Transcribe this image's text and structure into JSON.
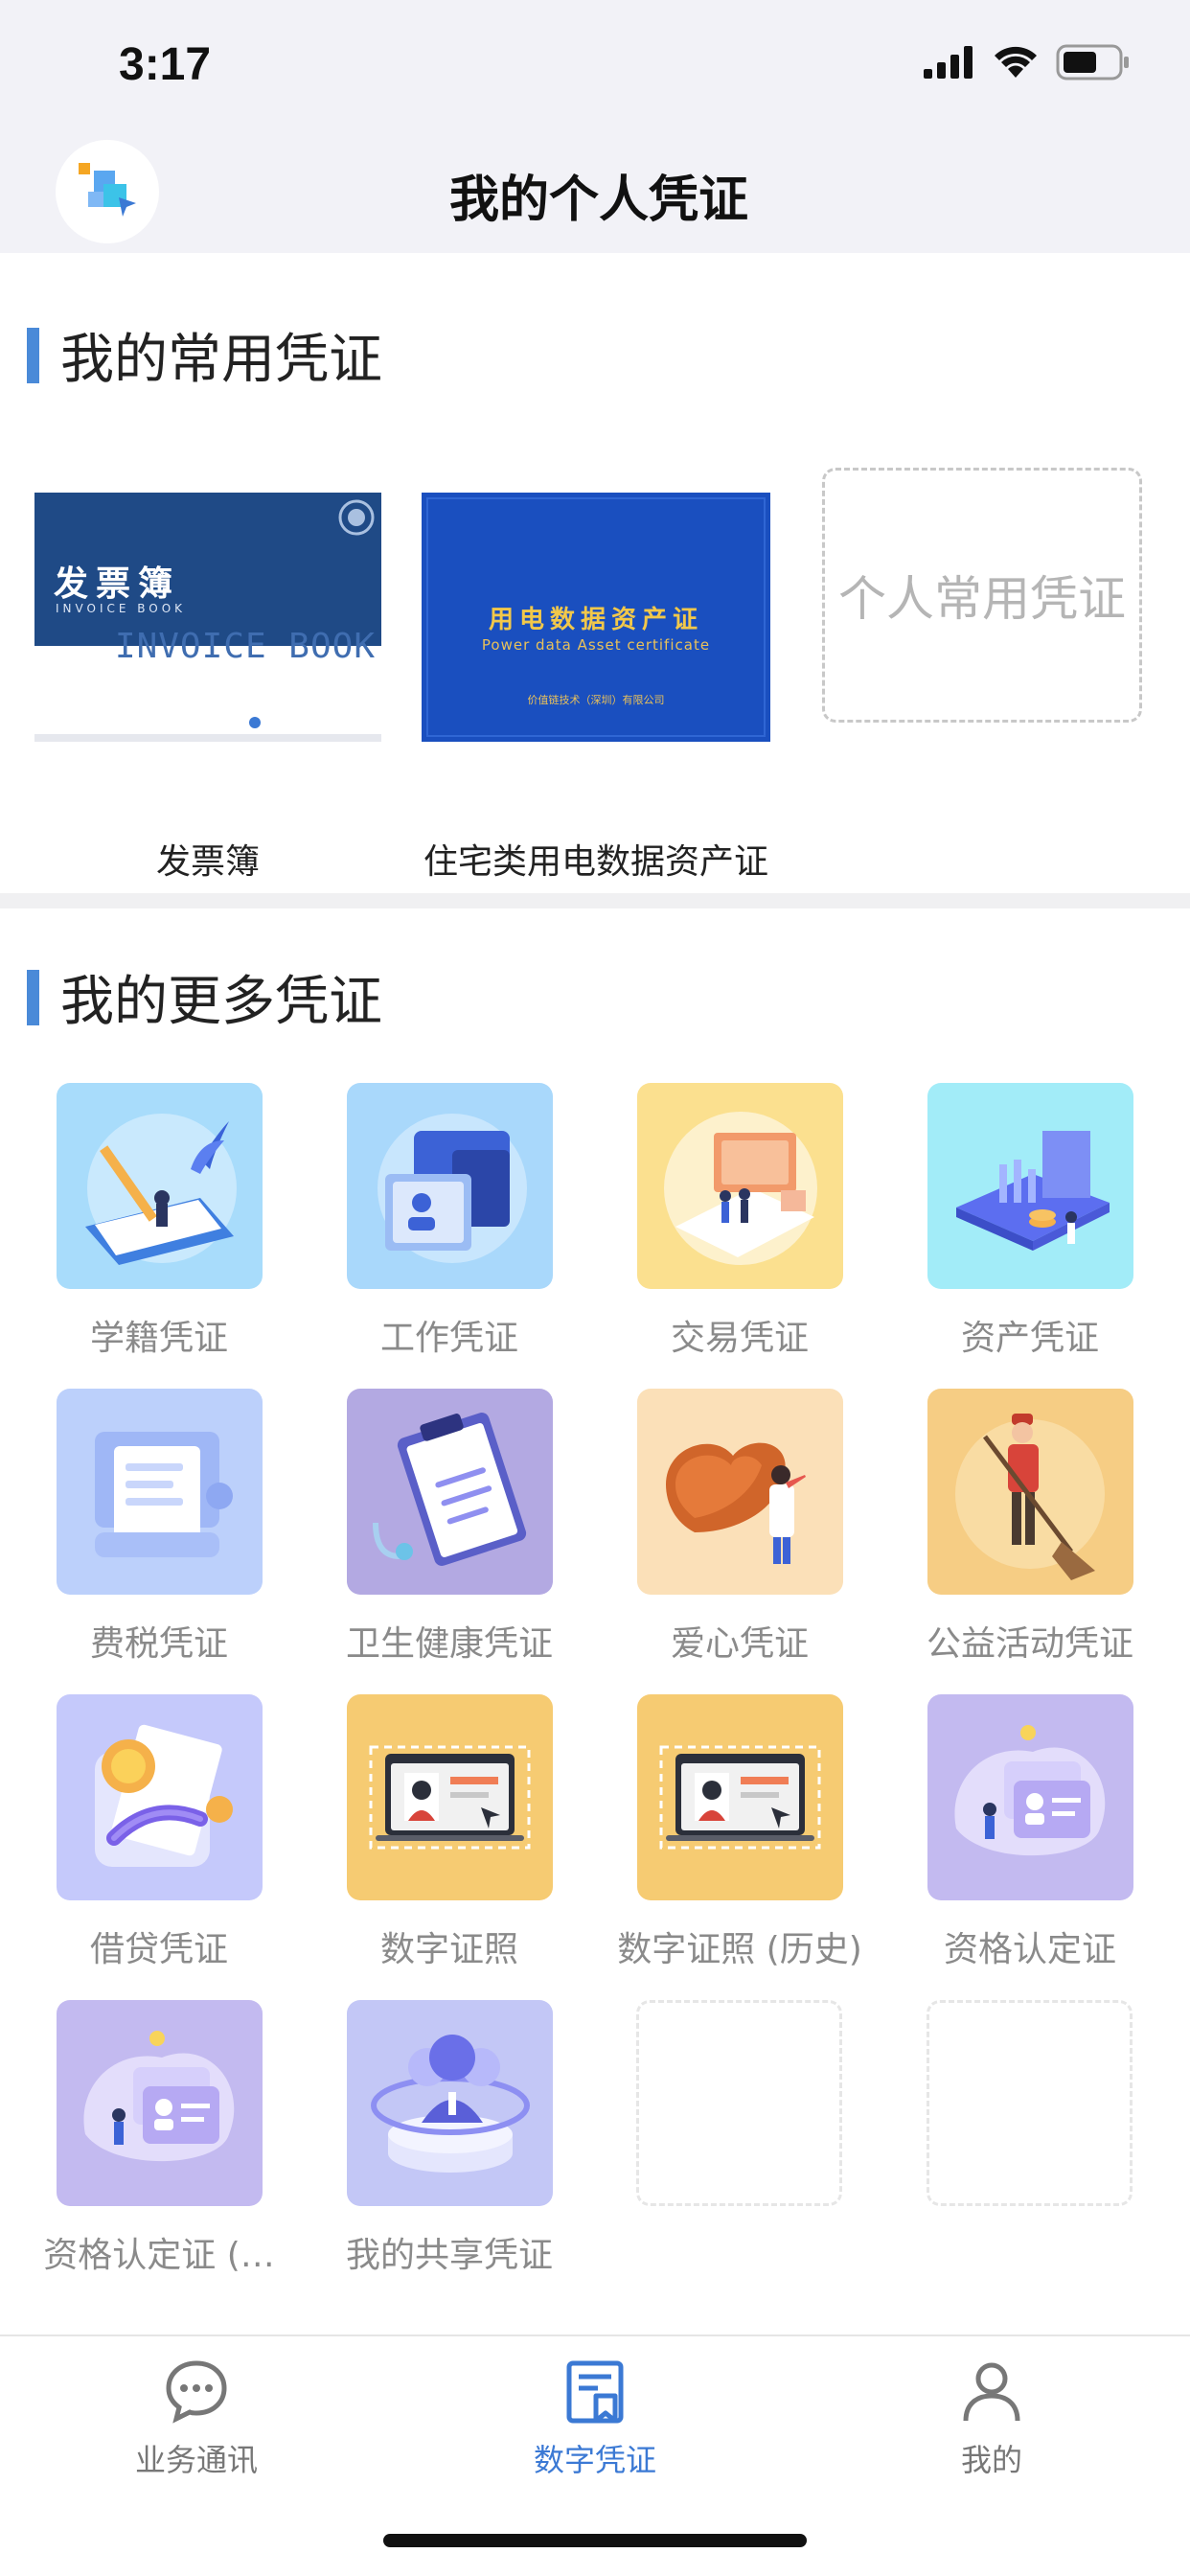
{
  "status_bar": {
    "time": "3:17"
  },
  "header": {
    "title": "我的个人凭证"
  },
  "favorites": {
    "section_title": "我的常用凭证",
    "cards": [
      {
        "label": "发票簿",
        "cover_title_cn": "发票簿",
        "cover_title_en_small": "INVOICE BOOK",
        "cover_title_en_big": "INVOICE BOOK"
      },
      {
        "label": "住宅类用电数据资产证",
        "cover_title_cn": "用电数据资产证",
        "cover_title_en": "Power data Asset certificate",
        "cover_issuer": "价值链技术（深圳）有限公司"
      }
    ],
    "placeholder": "个人常用凭证"
  },
  "more": {
    "section_title": "我的更多凭证",
    "items": [
      {
        "label": "学籍凭证",
        "icon": "education-credential-icon",
        "color": "#a8dcfb"
      },
      {
        "label": "工作凭证",
        "icon": "work-credential-icon",
        "color": "#a9d8fb"
      },
      {
        "label": "交易凭证",
        "icon": "trade-credential-icon",
        "color": "#fbe08f"
      },
      {
        "label": "资产凭证",
        "icon": "asset-credential-icon",
        "color": "#a2ecf8"
      },
      {
        "label": "费税凭证",
        "icon": "tax-credential-icon",
        "color": "#bcd0fb"
      },
      {
        "label": "卫生健康凭证",
        "icon": "health-credential-icon",
        "color": "#b3a9e2"
      },
      {
        "label": "爱心凭证",
        "icon": "charity-credential-icon",
        "color": "#fbe0b8"
      },
      {
        "label": "公益活动凭证",
        "icon": "volunteer-credential-icon",
        "color": "#f6cd84"
      },
      {
        "label": "借贷凭证",
        "icon": "loan-credential-icon",
        "color": "#c5c9fb"
      },
      {
        "label": "数字证照",
        "icon": "digital-license-icon",
        "color": "#f6cb72"
      },
      {
        "label": "数字证照 (历史)",
        "icon": "digital-license-history-icon",
        "color": "#f6cb72"
      },
      {
        "label": "资格认定证",
        "icon": "qualification-credential-icon",
        "color": "#c3baf0"
      },
      {
        "label": "资格认定证 (…",
        "icon": "qualification-credential-2-icon",
        "color": "#c3baf0"
      },
      {
        "label": "我的共享凭证",
        "icon": "shared-credential-icon",
        "color": "#c3c7f6"
      }
    ]
  },
  "tabbar": {
    "tabs": [
      {
        "label": "业务通讯",
        "icon": "chat-icon",
        "active": false
      },
      {
        "label": "数字凭证",
        "icon": "certificate-icon",
        "active": true
      },
      {
        "label": "我的",
        "icon": "user-icon",
        "active": false
      }
    ]
  },
  "colors": {
    "accent": "#3b79d4",
    "section_bar": "#4a8ad8"
  }
}
